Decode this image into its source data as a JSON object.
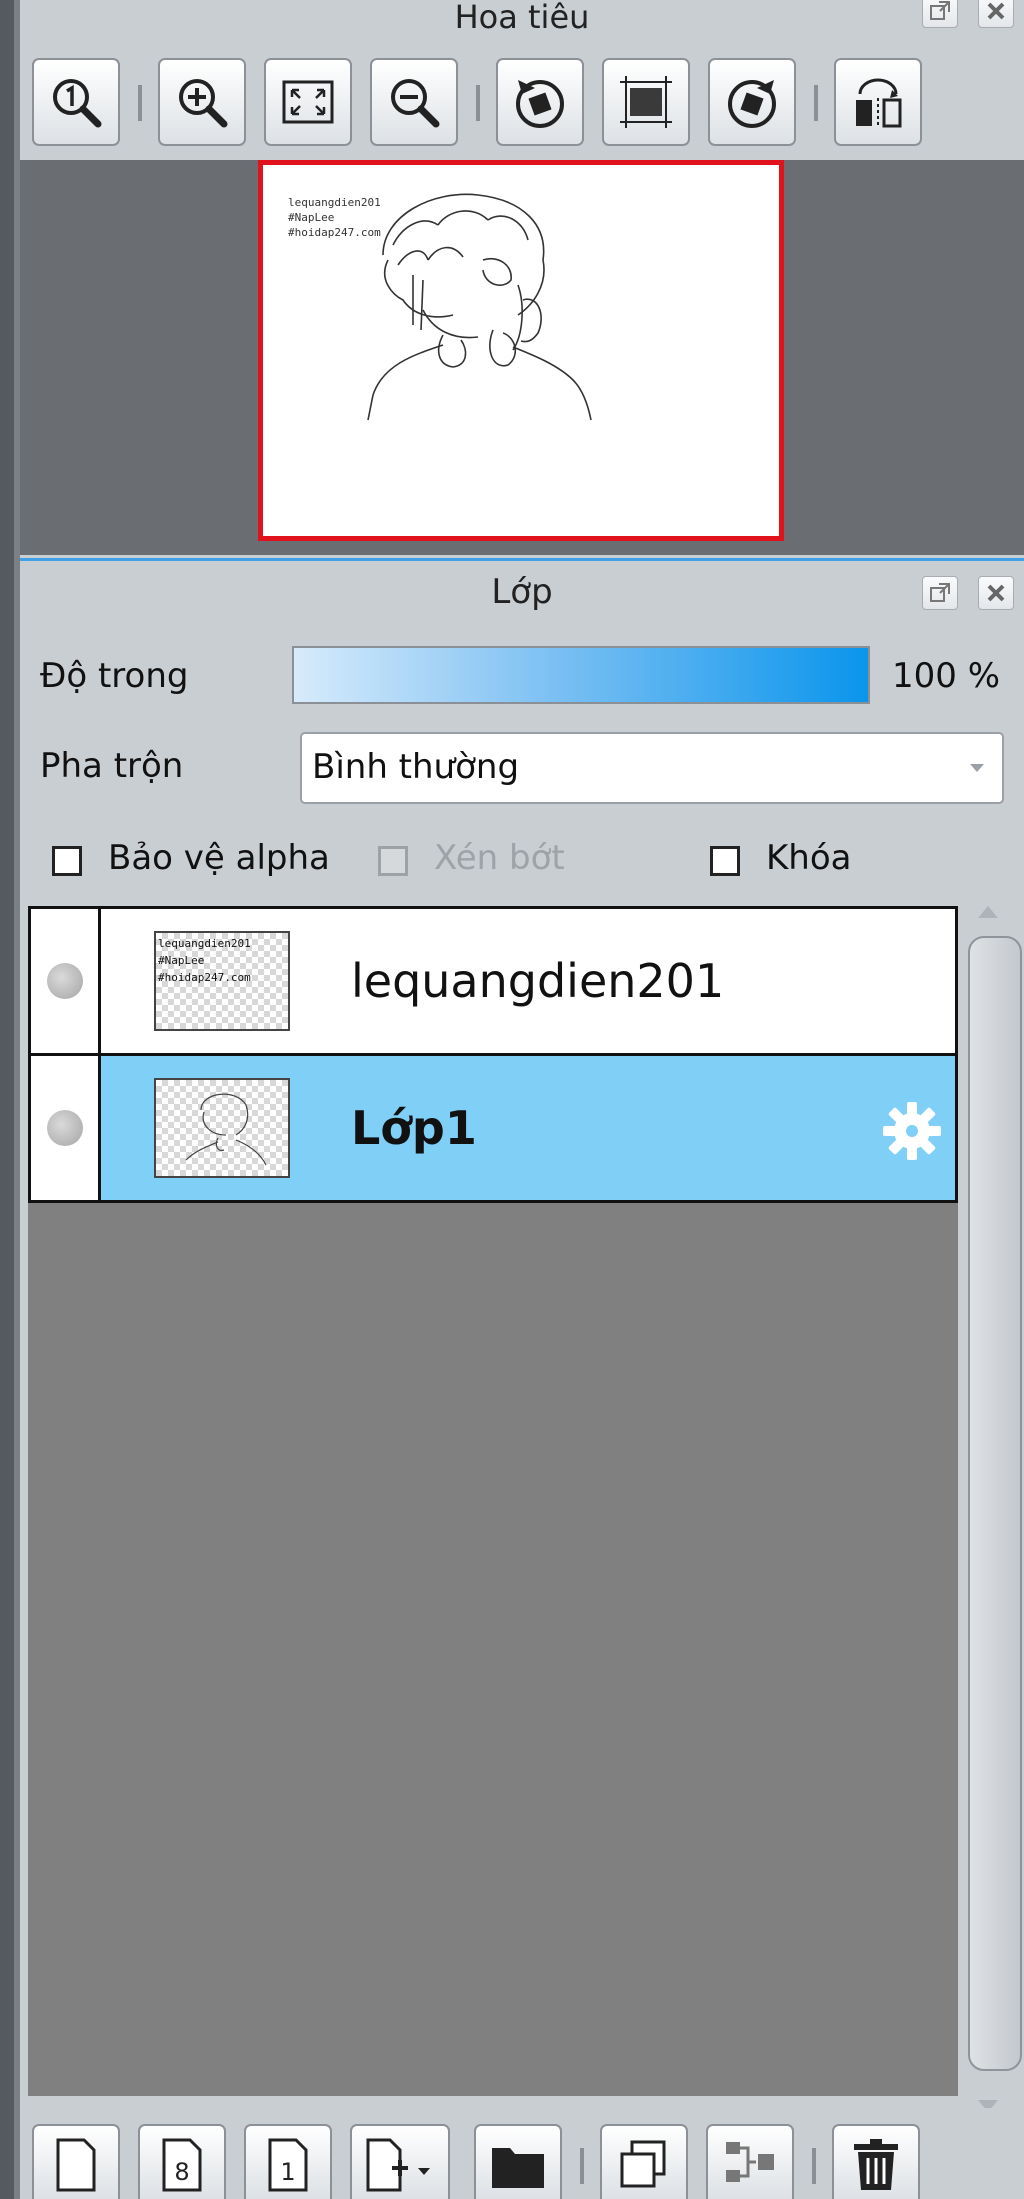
{
  "navigator": {
    "title": "Hoa tiêu",
    "preview_text": "lequangdien201\n#NapLee\n#hoidap247.com",
    "toolbar": [
      {
        "icon": "zoom-actual-size-icon"
      },
      {
        "icon": "zoom-in-icon"
      },
      {
        "icon": "fit-to-window-icon"
      },
      {
        "icon": "zoom-out-icon"
      },
      {
        "icon": "rotate-left-icon"
      },
      {
        "icon": "reset-rotation-icon"
      },
      {
        "icon": "rotate-right-icon"
      },
      {
        "icon": "flip-horizontal-icon"
      }
    ]
  },
  "layers": {
    "title": "Lớp",
    "opacity_label": "Độ trong",
    "opacity_value": "100 %",
    "opacity_fraction": 1.0,
    "blend_label": "Pha trộn",
    "blend_value": "Bình thường",
    "checkboxes": {
      "protect_alpha": {
        "label": "Bảo vệ alpha",
        "checked": false,
        "enabled": true
      },
      "clipping": {
        "label": "Xén bớt",
        "checked": false,
        "enabled": false
      },
      "lock": {
        "label": "Khóa",
        "checked": false,
        "enabled": true
      }
    },
    "items": [
      {
        "name": "lequangdien201",
        "thumb_text": "lequangdien201\n#NapLee\n#hoidap247.com",
        "selected": false,
        "visible": true
      },
      {
        "name": "Lớp1",
        "selected": true,
        "visible": true,
        "settings_icon": "gear-icon"
      }
    ],
    "bottom_toolbar": [
      {
        "icon": "new-layer-icon"
      },
      {
        "icon": "new-8bit-layer-icon",
        "glyph": "8"
      },
      {
        "icon": "new-1bit-layer-icon",
        "glyph": "1"
      },
      {
        "icon": "add-layer-menu-icon"
      },
      {
        "icon": "folder-icon"
      },
      {
        "icon": "duplicate-layer-icon"
      },
      {
        "icon": "merge-down-icon"
      },
      {
        "icon": "delete-layer-icon"
      }
    ],
    "colors": {
      "selected_row": "#80cff7",
      "accent": "#0a95ec",
      "list_bg": "#808080"
    }
  }
}
